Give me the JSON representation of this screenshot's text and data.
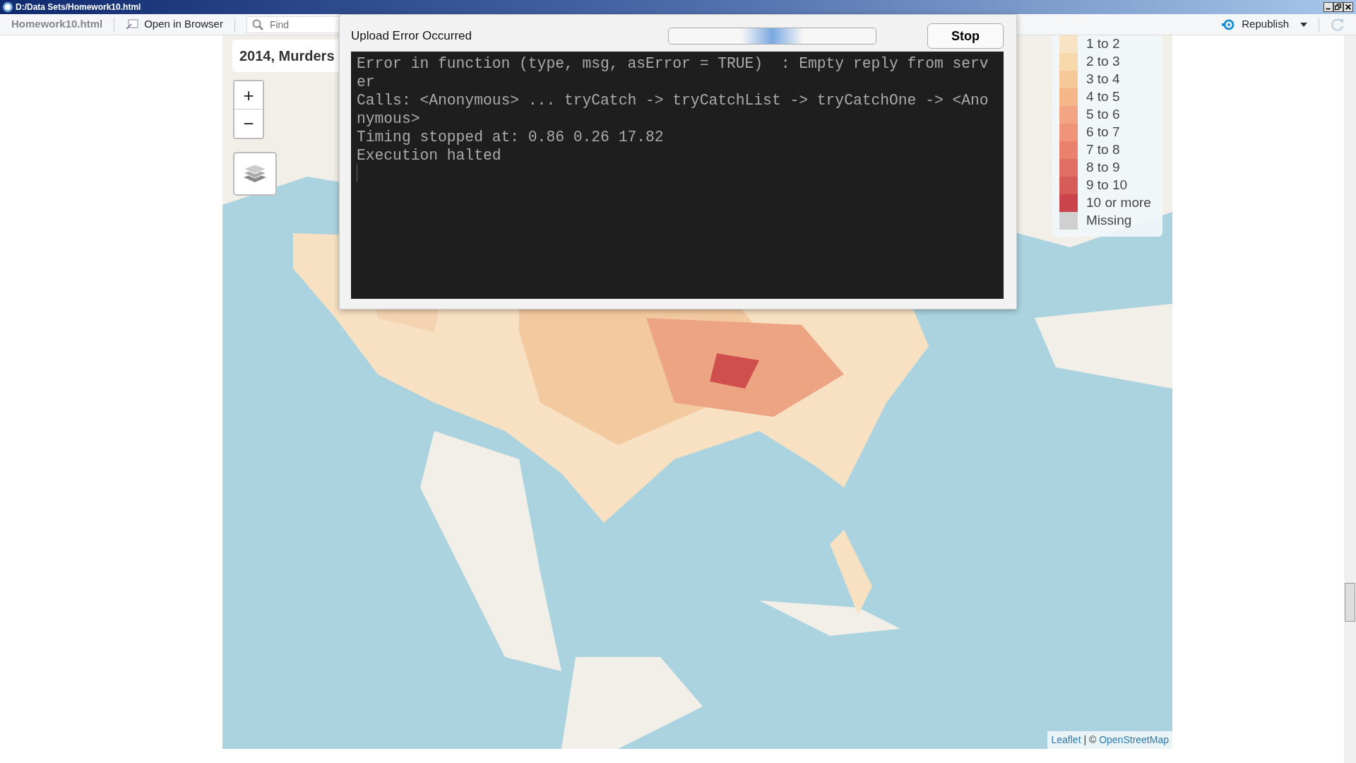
{
  "window": {
    "title": "D:/Data Sets/Homework10.html"
  },
  "toolbar": {
    "file_tab": "Homework10.html",
    "open_button": "Open in Browser",
    "find": {
      "placeholder": "Find"
    },
    "publish_button": "Republish"
  },
  "map": {
    "title": "2014, Murders",
    "zoom_in": "+",
    "zoom_out": "−",
    "legend": [
      {
        "label": "1 to 2",
        "color": "#f8e3c4"
      },
      {
        "label": "2 to 3",
        "color": "#f7d8ab"
      },
      {
        "label": "3 to 4",
        "color": "#f6c797"
      },
      {
        "label": "4 to 5",
        "color": "#f5b68a"
      },
      {
        "label": "5 to 6",
        "color": "#f3a583"
      },
      {
        "label": "6 to 7",
        "color": "#ef9479"
      },
      {
        "label": "7 to 8",
        "color": "#e9816d"
      },
      {
        "label": "8 to 9",
        "color": "#e06e63"
      },
      {
        "label": "9 to 10",
        "color": "#d65c58"
      },
      {
        "label": "10 or more",
        "color": "#c9454b"
      },
      {
        "label": "Missing",
        "color": "#d0d0d0"
      }
    ],
    "attribution": {
      "leaflet": "Leaflet",
      "separator": "| ©",
      "osm": "OpenStreetMap"
    }
  },
  "dialog": {
    "title": "Upload Error Occurred",
    "busy": true,
    "stop_button": "Stop",
    "console_lines": [
      "Error in function (type, msg, asError = TRUE)  : Empty reply from server",
      "Calls: <Anonymous> ... tryCatch -> tryCatchList -> tryCatchOne -> <Anonymous>",
      "Timing stopped at: 0.86 0.26 17.82",
      "Execution halted"
    ]
  }
}
